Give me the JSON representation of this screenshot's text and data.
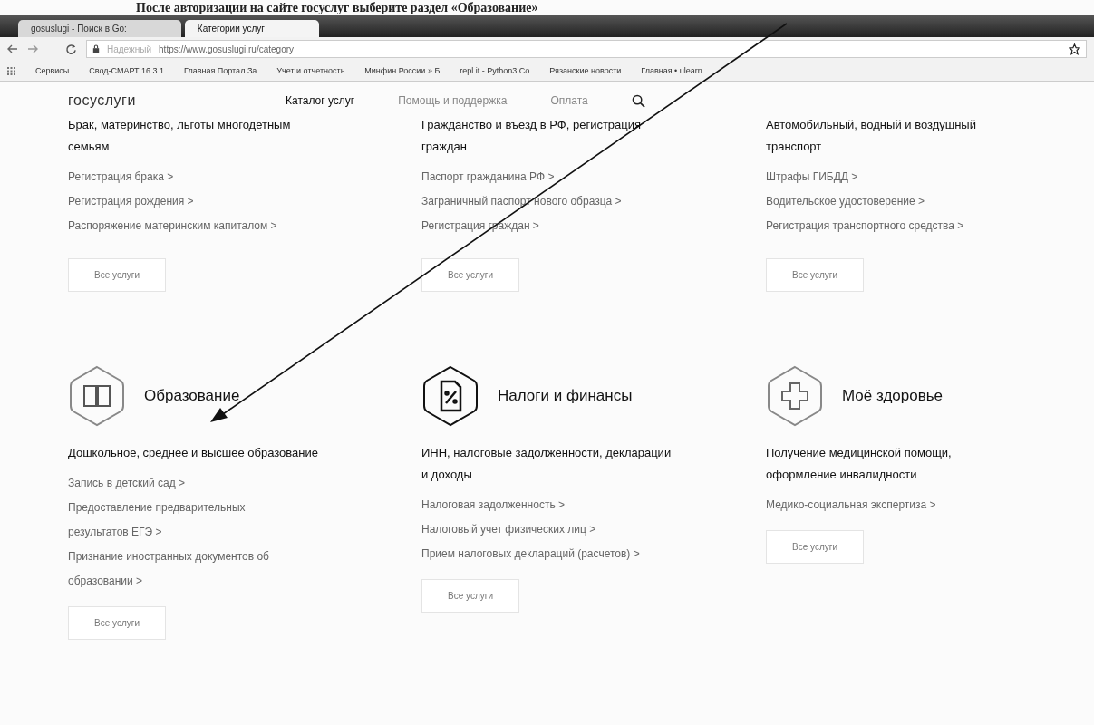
{
  "caption": "После авторизации на сайте госуслуг выберите раздел «Образование»",
  "browser": {
    "tabs": [
      {
        "label": "gosuslugi - Поиск в Go:",
        "selected": false
      },
      {
        "label": "Категории услуг",
        "selected": true
      }
    ],
    "address": {
      "security": "Надежный",
      "url": "https://www.gosuslugi.ru/category"
    },
    "bookmarks": [
      {
        "label": "Сервисы"
      },
      {
        "label": "Свод-СМАРТ 16.3.1"
      },
      {
        "label": "Главная Портал За"
      },
      {
        "label": "Учет и отчетность"
      },
      {
        "label": "Минфин России » Б"
      },
      {
        "label": "repl.it - Python3 Co"
      },
      {
        "label": "Рязанские новости"
      },
      {
        "label": "Главная • ulearn"
      }
    ]
  },
  "site": {
    "logo": "госуслуги",
    "nav": [
      {
        "label": "Каталог услуг",
        "selected": true
      },
      {
        "label": "Помощь и поддержка",
        "selected": false
      },
      {
        "label": "Оплата",
        "selected": false
      }
    ],
    "top_categories": [
      {
        "title": "Брак, материнство, льготы многодетным семьям",
        "links": [
          "Регистрация брака >",
          "Регистрация рождения >",
          "Распоряжение материнским капиталом >"
        ],
        "button": "Все услуги"
      },
      {
        "title": "Гражданство и въезд в РФ, регистрация граждан",
        "links": [
          "Паспорт гражданина РФ >",
          "Заграничный паспорт нового образца >",
          "Регистрация граждан >"
        ],
        "button": "Все услуги"
      },
      {
        "title": "Автомобильный, водный и воздушный транспорт",
        "links": [
          "Штрафы ГИБДД >",
          "Водительское удостоверение >",
          "Регистрация транспортного средства >"
        ],
        "button": "Все услуги"
      }
    ],
    "categories": [
      {
        "kind": "book",
        "title": "Образование",
        "subtitle": "Дошкольное, среднее и высшее образование",
        "links": [
          "Запись в детский сад >",
          "Предоставление предварительных результатов ЕГЭ >",
          "Признание иностранных документов об образовании >"
        ],
        "button": "Все услуги"
      },
      {
        "kind": "tax",
        "title": "Налоги и финансы",
        "subtitle": "ИНН, налоговые задолженности, декларации и доходы",
        "links": [
          "Налоговая задолженность >",
          "Налоговый учет физических лиц >",
          "Прием налоговых деклараций (расчетов) >"
        ],
        "button": "Все услуги"
      },
      {
        "kind": "health",
        "title": "Моё здоровье",
        "subtitle": "Получение медицинской помощи, оформление инвалидности",
        "links": [
          "Медико-социальная экспертиза >"
        ],
        "button": "Все услуги"
      }
    ]
  }
}
